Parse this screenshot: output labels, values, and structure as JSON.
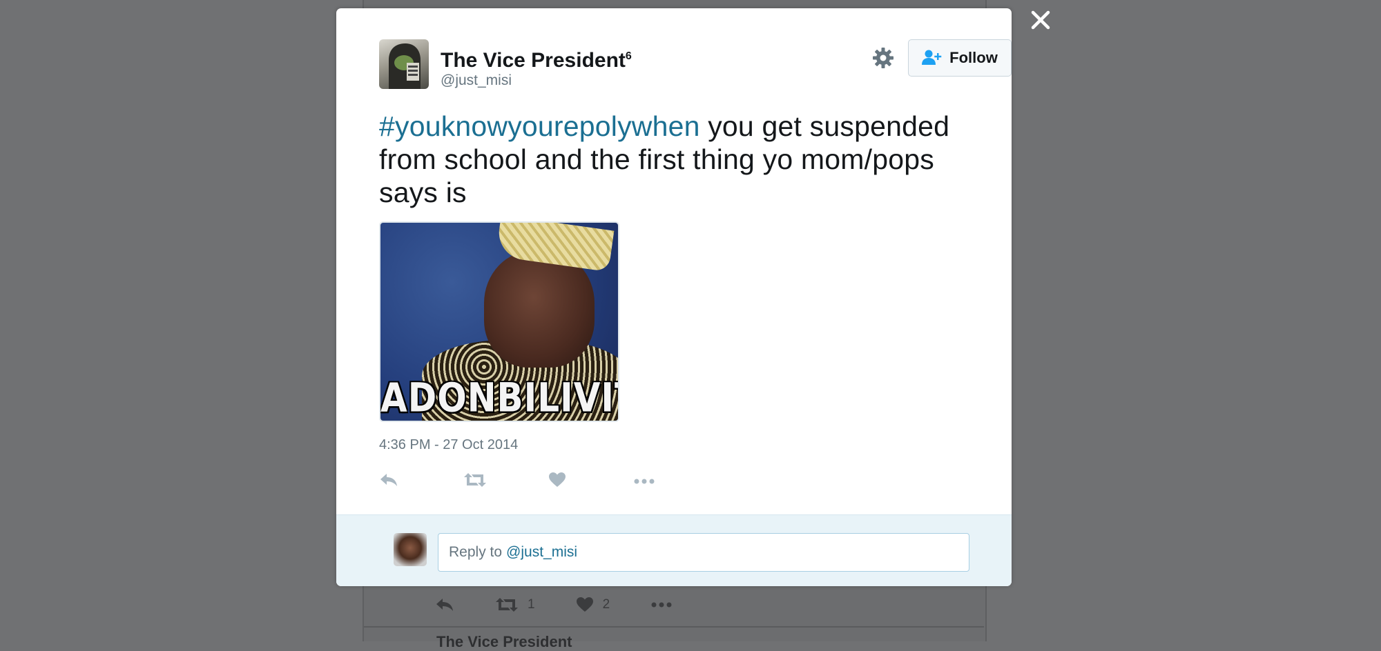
{
  "tweet": {
    "author": {
      "name": "The Vice President",
      "name_superscript": "6",
      "handle": "@just_misi"
    },
    "follow_label": "Follow",
    "text": {
      "hashtag": "#youknowyourepolywhen",
      "body": " you get suspended from school and the first thing yo mom/pops says is"
    },
    "media": {
      "caption": "ADONBILIVIT"
    },
    "timestamp": "4:36 PM - 27 Oct 2014",
    "actions": [
      {
        "name": "reply"
      },
      {
        "name": "retweet"
      },
      {
        "name": "like"
      },
      {
        "name": "more"
      }
    ]
  },
  "reply": {
    "prefix": "Reply to",
    "handle": "@just_misi"
  },
  "background": {
    "retweet_count": "1",
    "like_count": "2",
    "next_tweet_author": "The Vice President"
  },
  "colors": {
    "link": "#1b6f92",
    "overlay": "#707173",
    "reply_bar": "#e8f3f8"
  },
  "icons": [
    "close-icon",
    "gear-icon",
    "follow-user-icon",
    "reply-icon",
    "retweet-icon",
    "heart-icon",
    "more-icon"
  ]
}
